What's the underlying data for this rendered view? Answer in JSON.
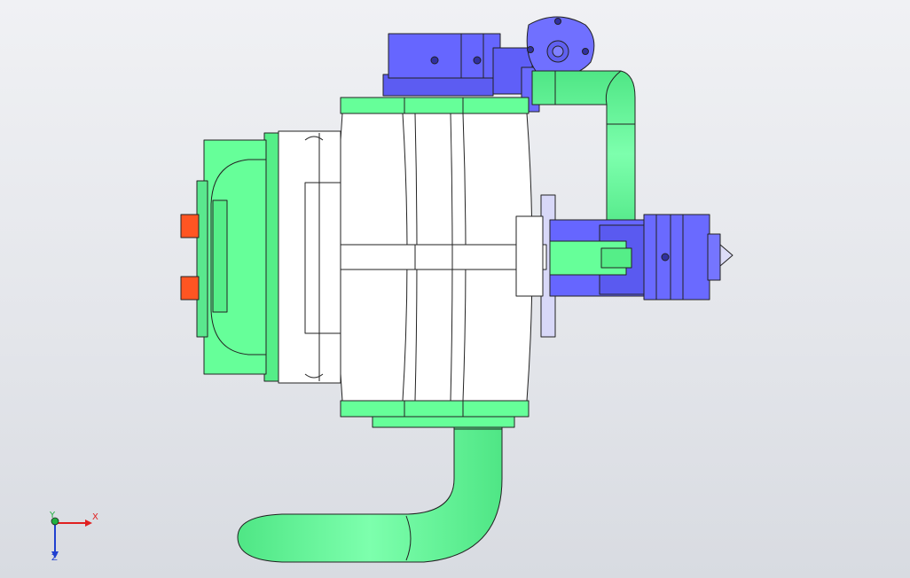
{
  "colors": {
    "green": "#66ff99",
    "blue": "#6666ff",
    "white": "#ffffff",
    "orange": "#ff5522",
    "lavender": "#d8d8f8",
    "outline": "#222222",
    "axis_x": "#e02020",
    "axis_z": "#2040d0",
    "axis_y": "#20b040"
  },
  "triad": {
    "x_label": "X",
    "y_label": "Y",
    "z_label": "Z"
  }
}
